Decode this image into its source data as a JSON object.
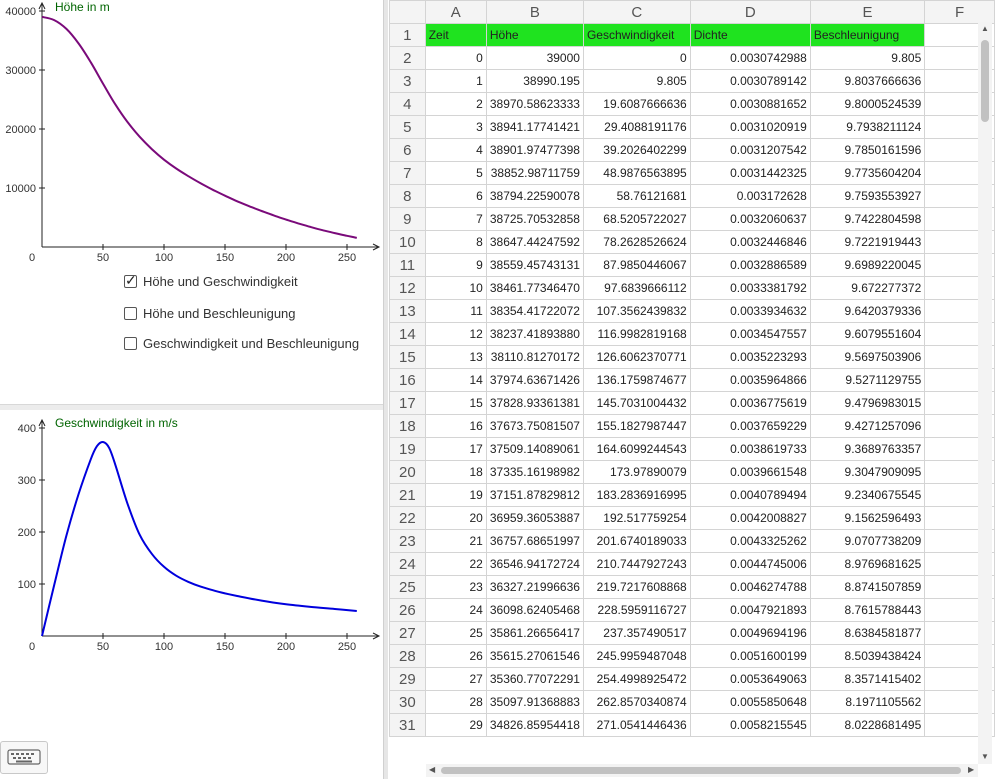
{
  "chart_data": [
    {
      "type": "line",
      "title": "Höhe in m",
      "xlabel": "",
      "ylabel": "Höhe in m",
      "xlim": [
        0,
        280
      ],
      "ylim": [
        0,
        40000
      ],
      "x_ticks": [
        "0",
        "50",
        "100",
        "150",
        "200",
        "250"
      ],
      "y_ticks": [
        "10000",
        "20000",
        "30000",
        "40000"
      ],
      "series": [
        {
          "color": "#7a0a7a",
          "x": [
            0,
            10,
            20,
            30,
            40,
            50,
            60,
            70,
            80,
            90,
            100,
            110,
            120,
            130,
            140,
            150,
            160,
            170,
            180,
            190,
            200,
            210,
            220,
            230,
            240,
            250,
            258
          ],
          "y": [
            39000,
            38462,
            36960,
            34500,
            31300,
            27700,
            24200,
            21200,
            18700,
            16600,
            14800,
            13300,
            12000,
            10800,
            9700,
            8700,
            7750,
            6900,
            6100,
            5350,
            4650,
            4000,
            3400,
            2850,
            2350,
            1900,
            1550
          ]
        }
      ]
    },
    {
      "type": "line",
      "title": "Geschwindigkeit in m/s",
      "xlabel": "",
      "ylabel": "Geschwindigkeit in m/s",
      "xlim": [
        0,
        280
      ],
      "ylim": [
        0,
        400
      ],
      "x_ticks": [
        "0",
        "50",
        "100",
        "150",
        "200",
        "250"
      ],
      "y_ticks": [
        "100",
        "200",
        "300",
        "400"
      ],
      "series": [
        {
          "color": "#0000dd",
          "x": [
            0,
            10,
            20,
            30,
            40,
            45,
            50,
            55,
            60,
            70,
            80,
            90,
            100,
            110,
            120,
            130,
            140,
            150,
            160,
            180,
            200,
            220,
            240,
            258
          ],
          "y": [
            0,
            98,
            193,
            273,
            340,
            365,
            373,
            362,
            330,
            255,
            195,
            158,
            133,
            116,
            104,
            95,
            88,
            82,
            77,
            68,
            61,
            56,
            52,
            48
          ]
        }
      ]
    }
  ],
  "checkboxes": [
    {
      "label": "Höhe und Geschwindigkeit",
      "checked": true
    },
    {
      "label": "Höhe und Beschleunigung",
      "checked": false
    },
    {
      "label": "Geschwindigkeit und Beschleunigung",
      "checked": false
    }
  ],
  "keyboard_icon": "keyboard-icon",
  "spreadsheet": {
    "columns": [
      "A",
      "B",
      "C",
      "D",
      "E",
      "F"
    ],
    "headers": [
      "Zeit",
      "Höhe",
      "Geschwindigkeit",
      "Dichte",
      "Beschleunigung"
    ],
    "header_color": "#1fe31f",
    "rows": [
      [
        "0",
        "39000",
        "0",
        "0.0030742988",
        "9.805"
      ],
      [
        "1",
        "38990.195",
        "9.805",
        "0.0030789142",
        "9.8037666636"
      ],
      [
        "2",
        "38970.58623333",
        "19.6087666636",
        "0.0030881652",
        "9.8000524539"
      ],
      [
        "3",
        "38941.17741421",
        "29.4088191176",
        "0.0031020919",
        "9.7938211124"
      ],
      [
        "4",
        "38901.97477398",
        "39.2026402299",
        "0.0031207542",
        "9.7850161596"
      ],
      [
        "5",
        "38852.98711759",
        "48.9876563895",
        "0.0031442325",
        "9.7735604204"
      ],
      [
        "6",
        "38794.22590078",
        "58.76121681",
        "0.003172628",
        "9.7593553927"
      ],
      [
        "7",
        "38725.70532858",
        "68.5205722027",
        "0.0032060637",
        "9.7422804598"
      ],
      [
        "8",
        "38647.44247592",
        "78.2628526624",
        "0.0032446846",
        "9.7221919443"
      ],
      [
        "9",
        "38559.45743131",
        "87.9850446067",
        "0.0032886589",
        "9.6989220045"
      ],
      [
        "10",
        "38461.77346470",
        "97.6839666112",
        "0.0033381792",
        "9.672277372"
      ],
      [
        "11",
        "38354.41722072",
        "107.3562439832",
        "0.0033934632",
        "9.6420379336"
      ],
      [
        "12",
        "38237.41893880",
        "116.9982819168",
        "0.0034547557",
        "9.6079551604"
      ],
      [
        "13",
        "38110.81270172",
        "126.6062370771",
        "0.0035223293",
        "9.5697503906"
      ],
      [
        "14",
        "37974.63671426",
        "136.1759874677",
        "0.0035964866",
        "9.5271129755"
      ],
      [
        "15",
        "37828.93361381",
        "145.7031004432",
        "0.0036775619",
        "9.4796983015"
      ],
      [
        "16",
        "37673.75081507",
        "155.1827987447",
        "0.0037659229",
        "9.4271257096"
      ],
      [
        "17",
        "37509.14089061",
        "164.6099244543",
        "0.0038619733",
        "9.3689763357"
      ],
      [
        "18",
        "37335.16198982",
        "173.97890079",
        "0.0039661548",
        "9.3047909095"
      ],
      [
        "19",
        "37151.87829812",
        "183.2836916995",
        "0.0040789494",
        "9.2340675545"
      ],
      [
        "20",
        "36959.36053887",
        "192.517759254",
        "0.0042008827",
        "9.1562596493"
      ],
      [
        "21",
        "36757.68651997",
        "201.6740189033",
        "0.0043325262",
        "9.0707738209"
      ],
      [
        "22",
        "36546.94172724",
        "210.7447927243",
        "0.0044745006",
        "8.9769681625"
      ],
      [
        "23",
        "36327.21996636",
        "219.7217608868",
        "0.0046274788",
        "8.8741507859"
      ],
      [
        "24",
        "36098.62405468",
        "228.5959116727",
        "0.0047921893",
        "8.7615788443"
      ],
      [
        "25",
        "35861.26656417",
        "237.357490517",
        "0.0049694196",
        "8.6384581877"
      ],
      [
        "26",
        "35615.27061546",
        "245.9959487048",
        "0.0051600199",
        "8.5039438424"
      ],
      [
        "27",
        "35360.77072291",
        "254.4998925472",
        "0.0053649063",
        "8.3571415402"
      ],
      [
        "28",
        "35097.91368883",
        "262.8570340874",
        "0.0055850648",
        "8.1971105562"
      ],
      [
        "29",
        "34826.85954418",
        "271.0541446436",
        "0.0058215545",
        "8.0228681495"
      ]
    ]
  }
}
